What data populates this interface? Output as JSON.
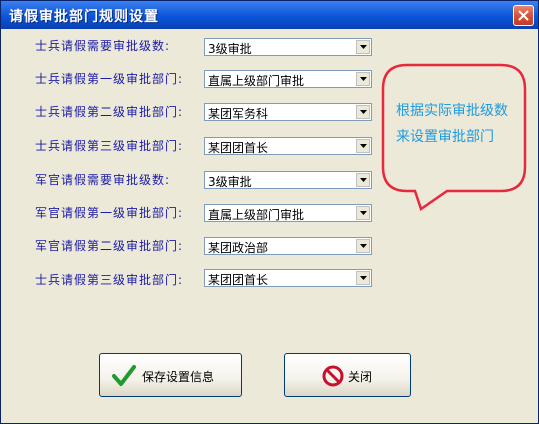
{
  "window": {
    "title": "请假审批部门规则设置"
  },
  "rows": [
    {
      "label": "士兵请假需要审批级数:",
      "value": "3级审批"
    },
    {
      "label": "士兵请假第一级审批部门:",
      "value": "直属上级部门审批"
    },
    {
      "label": "士兵请假第二级审批部门:",
      "value": "某团军务科"
    },
    {
      "label": "士兵请假第三级审批部门:",
      "value": "某团团首长"
    },
    {
      "label": "军官请假需要审批级数:",
      "value": "3级审批"
    },
    {
      "label": "军官请假第一级审批部门:",
      "value": "直属上级部门审批"
    },
    {
      "label": "军官请假第二级审批部门:",
      "value": "某团政治部"
    },
    {
      "label": "士兵请假第三级审批部门:",
      "value": "某团团首长"
    }
  ],
  "tip": {
    "line1": "根据实际审批级数",
    "line2": "来设置审批部门"
  },
  "buttons": {
    "save": "保存设置信息",
    "close": "关闭"
  },
  "colors": {
    "label": "#1A1AA8",
    "bubble": "#E8283C",
    "tip": "#1E9BE0",
    "titlebar": "#0B55D8"
  },
  "icons": {
    "save": "check-icon",
    "close": "no-entry-icon",
    "window_close": "close-icon"
  }
}
